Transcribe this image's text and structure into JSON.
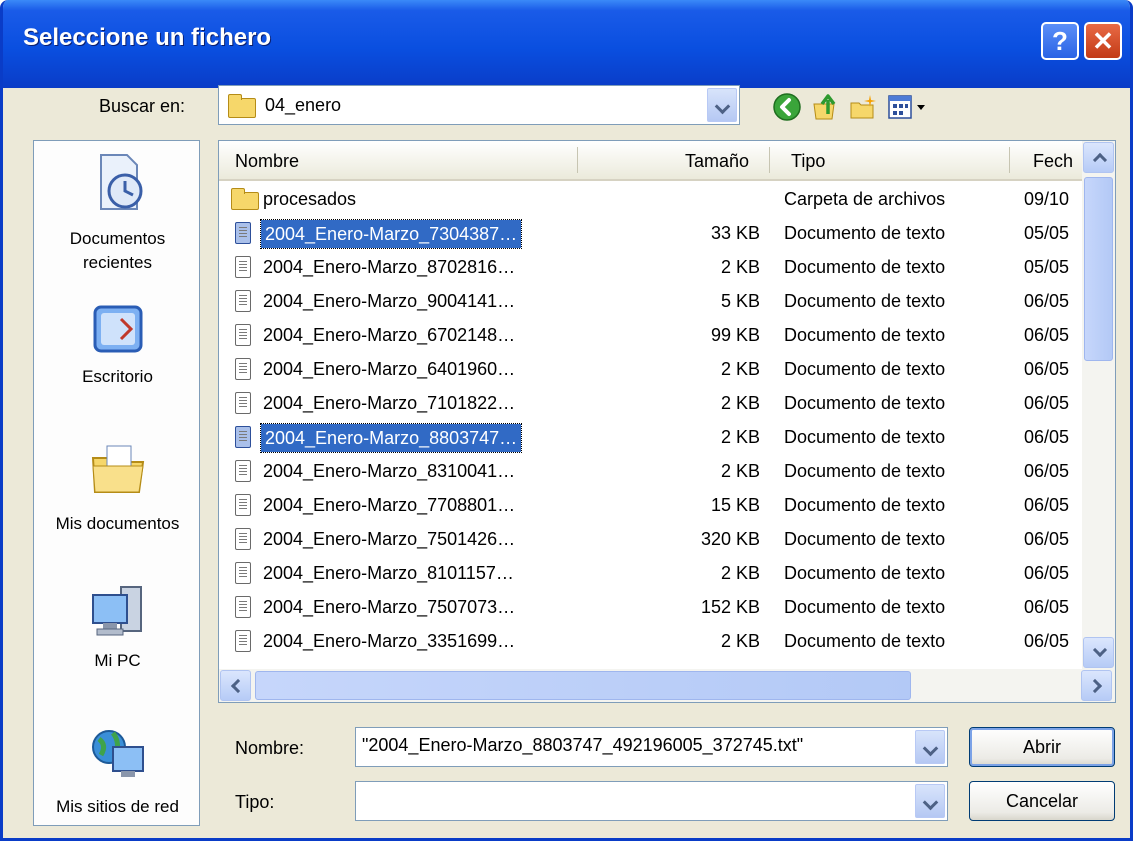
{
  "window": {
    "title": "Seleccione un fichero",
    "help_label": "?",
    "close_label": "✕"
  },
  "lookin": {
    "label": "Buscar en:",
    "value": "04_enero"
  },
  "toolbar": {
    "back_icon": "back-arrow-icon",
    "up_icon": "up-folder-icon",
    "new_folder_icon": "new-folder-icon",
    "view_icon": "view-menu-icon"
  },
  "places": [
    {
      "label": "Documentos recientes",
      "icon": "recent-documents-icon"
    },
    {
      "label": "Escritorio",
      "icon": "desktop-icon"
    },
    {
      "label": "Mis documentos",
      "icon": "my-documents-icon"
    },
    {
      "label": "Mi PC",
      "icon": "my-computer-icon"
    },
    {
      "label": "Mis sitios de red",
      "icon": "network-places-icon"
    }
  ],
  "columns": {
    "name": "Nombre",
    "size": "Tamaño",
    "type": "Tipo",
    "date": "Fech"
  },
  "files": [
    {
      "name": "procesados",
      "size": "",
      "type": "Carpeta de archivos",
      "date": "09/10",
      "kind": "folder",
      "selected": false
    },
    {
      "name": "2004_Enero-Marzo_7304387…",
      "size": "33 KB",
      "type": "Documento de texto",
      "date": "05/05",
      "kind": "doc",
      "selected": true
    },
    {
      "name": "2004_Enero-Marzo_8702816…",
      "size": "2 KB",
      "type": "Documento de texto",
      "date": "05/05",
      "kind": "doc",
      "selected": false
    },
    {
      "name": "2004_Enero-Marzo_9004141…",
      "size": "5 KB",
      "type": "Documento de texto",
      "date": "06/05",
      "kind": "doc",
      "selected": false
    },
    {
      "name": "2004_Enero-Marzo_6702148…",
      "size": "99 KB",
      "type": "Documento de texto",
      "date": "06/05",
      "kind": "doc",
      "selected": false
    },
    {
      "name": "2004_Enero-Marzo_6401960…",
      "size": "2 KB",
      "type": "Documento de texto",
      "date": "06/05",
      "kind": "doc",
      "selected": false
    },
    {
      "name": "2004_Enero-Marzo_7101822…",
      "size": "2 KB",
      "type": "Documento de texto",
      "date": "06/05",
      "kind": "doc",
      "selected": false
    },
    {
      "name": "2004_Enero-Marzo_8803747…",
      "size": "2 KB",
      "type": "Documento de texto",
      "date": "06/05",
      "kind": "doc",
      "selected": true
    },
    {
      "name": "2004_Enero-Marzo_8310041…",
      "size": "2 KB",
      "type": "Documento de texto",
      "date": "06/05",
      "kind": "doc",
      "selected": false
    },
    {
      "name": "2004_Enero-Marzo_7708801…",
      "size": "15 KB",
      "type": "Documento de texto",
      "date": "06/05",
      "kind": "doc",
      "selected": false
    },
    {
      "name": "2004_Enero-Marzo_7501426…",
      "size": "320 KB",
      "type": "Documento de texto",
      "date": "06/05",
      "kind": "doc",
      "selected": false
    },
    {
      "name": "2004_Enero-Marzo_8101157…",
      "size": "2 KB",
      "type": "Documento de texto",
      "date": "06/05",
      "kind": "doc",
      "selected": false
    },
    {
      "name": "2004_Enero-Marzo_7507073…",
      "size": "152 KB",
      "type": "Documento de texto",
      "date": "06/05",
      "kind": "doc",
      "selected": false
    },
    {
      "name": "2004_Enero-Marzo_3351699…",
      "size": "2 KB",
      "type": "Documento de texto",
      "date": "06/05",
      "kind": "doc",
      "selected": false
    }
  ],
  "filename": {
    "label": "Nombre:",
    "value": "\"2004_Enero-Marzo_8803747_492196005_372745.txt\""
  },
  "filetype": {
    "label": "Tipo:",
    "value": ""
  },
  "buttons": {
    "open": "Abrir",
    "cancel": "Cancelar"
  },
  "colors": {
    "titlebar": "#0a4fe0",
    "selection": "#316ac5",
    "dialog_bg": "#ece9d8"
  }
}
